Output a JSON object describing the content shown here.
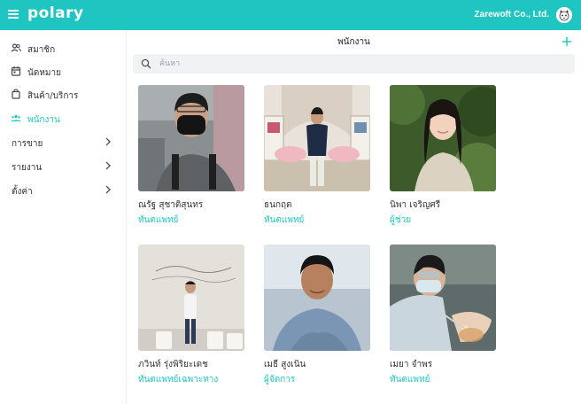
{
  "header": {
    "logo": "polary",
    "company": "Zarewoft Co., Ltd."
  },
  "sidebar": {
    "items": [
      {
        "label": "สมาชิก",
        "icon": "members-icon"
      },
      {
        "label": "นัดหมาย",
        "icon": "calendar-icon"
      },
      {
        "label": "สินค้า/บริการ",
        "icon": "shopping-bag-icon"
      },
      {
        "label": "พนักงาน",
        "icon": "staff-icon",
        "active": true
      },
      {
        "label": "การขาย",
        "expandable": true
      },
      {
        "label": "รายงาน",
        "expandable": true
      },
      {
        "label": "ตั้งค่า",
        "expandable": true
      }
    ]
  },
  "main": {
    "title": "พนักงาน",
    "search_placeholder": "ค้นหา",
    "employees": [
      {
        "name": "ณรัฐ สุชาติสุนทร",
        "role": "ทันตแพทย์"
      },
      {
        "name": "ธนกฤต",
        "role": "ทันตแพทย์"
      },
      {
        "name": "นิพา เจริญศรี",
        "role": "ผู้ช่วย"
      },
      {
        "name": "ภวินท์ รุ่งพิริยะเดช",
        "role": "ทันตแพทย์เฉพาะทาง"
      },
      {
        "name": "เมธี สูงเนิน",
        "role": "ผู้จัดการ"
      },
      {
        "name": "เมยา จำพร",
        "role": "ทันตแพทย์"
      }
    ]
  },
  "colors": {
    "accent": "#1fc5c0",
    "search_bg": "#f1f2f4"
  }
}
